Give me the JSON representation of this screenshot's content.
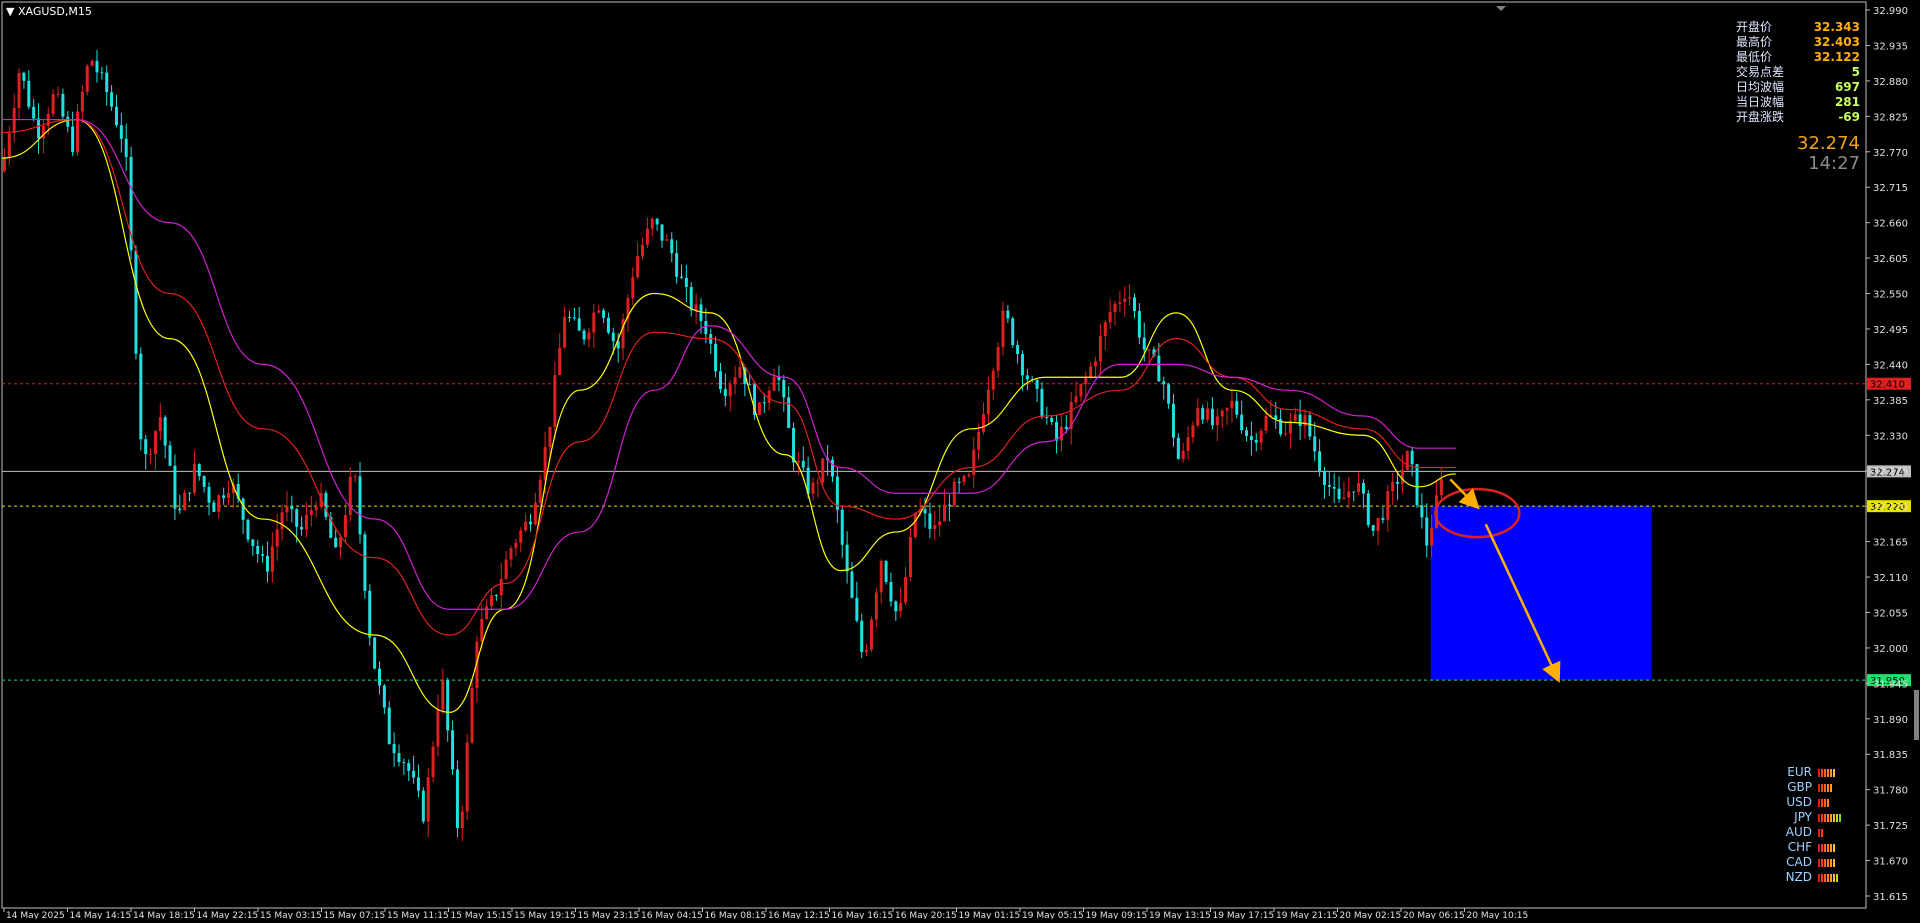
{
  "header": {
    "symbol": "XAGUSD,M15"
  },
  "chart_data": {
    "type": "candlestick",
    "symbol": "XAGUSD",
    "timeframe": "M15",
    "ylim": [
      31.615,
      32.99
    ],
    "y_ticks": [
      32.99,
      32.935,
      32.88,
      32.825,
      32.77,
      32.715,
      32.66,
      32.605,
      32.55,
      32.495,
      32.44,
      32.385,
      32.33,
      32.275,
      32.22,
      32.165,
      32.11,
      32.055,
      32.0,
      31.945,
      31.89,
      31.835,
      31.78,
      31.725,
      31.67,
      31.615
    ],
    "y_tick_labels": [
      "32.990",
      "32.935",
      "32.880",
      "32.825",
      "32.770",
      "32.715",
      "32.660",
      "32.605",
      "32.550",
      "32.495",
      "32.440",
      "32.385",
      "32.330",
      "32.275",
      "32.220",
      "32.165",
      "32.110",
      "32.055",
      "32.000",
      "31.945",
      "31.890",
      "31.835",
      "31.780",
      "31.725",
      "31.670",
      "31.615"
    ],
    "x_tick_labels": [
      "14 May 2025",
      "14 May 14:15",
      "14 May 18:15",
      "14 May 22:15",
      "15 May 03:15",
      "15 May 07:15",
      "15 May 11:15",
      "15 May 15:15",
      "15 May 19:15",
      "15 May 23:15",
      "16 May 04:15",
      "16 May 08:15",
      "16 May 12:15",
      "16 May 16:15",
      "16 May 20:15",
      "19 May 01:15",
      "19 May 05:15",
      "19 May 09:15",
      "19 May 13:15",
      "19 May 17:15",
      "19 May 21:15",
      "20 May 02:15",
      "20 May 06:15",
      "20 May 10:15"
    ],
    "levels": [
      {
        "price": 32.41,
        "label": "32.410",
        "color": "#e02020",
        "style": "dashed"
      },
      {
        "price": 32.274,
        "label": "32.274",
        "color": "#c0c0c0",
        "style": "solid"
      },
      {
        "price": 32.22,
        "label": "32.220",
        "color": "#e8e000",
        "style": "dashed"
      },
      {
        "price": 31.95,
        "label": "31.950",
        "color": "#20e070",
        "style": "dashed"
      }
    ],
    "price_path": [
      32.74,
      32.9,
      32.8,
      32.86,
      32.78,
      32.92,
      32.86,
      32.78,
      32.28,
      32.36,
      32.2,
      32.28,
      32.22,
      32.26,
      32.18,
      32.12,
      32.22,
      32.18,
      32.24,
      32.14,
      32.28,
      32.0,
      31.86,
      31.82,
      31.74,
      31.96,
      31.7,
      32.02,
      32.08,
      32.16,
      32.2,
      32.32,
      32.52,
      32.48,
      32.54,
      32.46,
      32.6,
      32.66,
      32.62,
      32.54,
      32.5,
      32.4,
      32.44,
      32.36,
      32.44,
      32.3,
      32.24,
      32.3,
      32.12,
      31.98,
      32.14,
      32.04,
      32.22,
      32.18,
      32.24,
      32.26,
      32.4,
      32.52,
      32.44,
      32.38,
      32.32,
      32.38,
      32.44,
      32.52,
      32.56,
      32.46,
      32.42,
      32.28,
      32.38,
      32.34,
      32.38,
      32.32,
      32.36,
      32.34,
      32.36,
      32.28,
      32.22,
      32.26,
      32.18,
      32.24,
      32.3,
      32.16,
      32.27
    ],
    "moving_averages": [
      {
        "color": "#ffff00",
        "points": [
          [
            0,
            32.76
          ],
          [
            0.04,
            32.82
          ],
          [
            0.09,
            32.48
          ],
          [
            0.14,
            32.2
          ],
          [
            0.2,
            32.02
          ],
          [
            0.24,
            31.9
          ],
          [
            0.27,
            32.06
          ],
          [
            0.31,
            32.4
          ],
          [
            0.35,
            32.55
          ],
          [
            0.38,
            32.52
          ],
          [
            0.42,
            32.3
          ],
          [
            0.45,
            32.12
          ],
          [
            0.48,
            32.18
          ],
          [
            0.52,
            32.34
          ],
          [
            0.56,
            32.42
          ],
          [
            0.6,
            32.42
          ],
          [
            0.63,
            32.52
          ],
          [
            0.66,
            32.4
          ],
          [
            0.69,
            32.35
          ],
          [
            0.73,
            32.33
          ],
          [
            0.76,
            32.25
          ],
          [
            0.78,
            32.27
          ]
        ]
      },
      {
        "color": "#e02020",
        "points": [
          [
            0,
            32.8
          ],
          [
            0.04,
            32.82
          ],
          [
            0.09,
            32.55
          ],
          [
            0.14,
            32.34
          ],
          [
            0.2,
            32.14
          ],
          [
            0.24,
            32.02
          ],
          [
            0.27,
            32.1
          ],
          [
            0.31,
            32.32
          ],
          [
            0.35,
            32.49
          ],
          [
            0.38,
            32.48
          ],
          [
            0.42,
            32.38
          ],
          [
            0.45,
            32.22
          ],
          [
            0.48,
            32.2
          ],
          [
            0.52,
            32.28
          ],
          [
            0.56,
            32.36
          ],
          [
            0.6,
            32.4
          ],
          [
            0.63,
            32.48
          ],
          [
            0.66,
            32.42
          ],
          [
            0.69,
            32.37
          ],
          [
            0.73,
            32.34
          ],
          [
            0.76,
            32.28
          ],
          [
            0.78,
            32.28
          ]
        ]
      },
      {
        "color": "#d020d0",
        "points": [
          [
            0,
            32.82
          ],
          [
            0.04,
            32.82
          ],
          [
            0.09,
            32.66
          ],
          [
            0.14,
            32.44
          ],
          [
            0.2,
            32.2
          ],
          [
            0.24,
            32.06
          ],
          [
            0.27,
            32.06
          ],
          [
            0.31,
            32.18
          ],
          [
            0.35,
            32.4
          ],
          [
            0.38,
            32.5
          ],
          [
            0.42,
            32.42
          ],
          [
            0.45,
            32.28
          ],
          [
            0.48,
            32.24
          ],
          [
            0.52,
            32.24
          ],
          [
            0.56,
            32.32
          ],
          [
            0.6,
            32.44
          ],
          [
            0.63,
            32.44
          ],
          [
            0.66,
            32.42
          ],
          [
            0.69,
            32.4
          ],
          [
            0.73,
            32.36
          ],
          [
            0.76,
            32.31
          ],
          [
            0.78,
            32.31
          ]
        ]
      }
    ],
    "target_zone": {
      "color": "#0000ff",
      "from_price": 32.22,
      "to_price": 31.95
    },
    "annotations": [
      {
        "type": "ellipse",
        "color": "#e02020"
      },
      {
        "type": "arrow",
        "color": "#ffb000",
        "from": 32.274,
        "to": 32.22
      },
      {
        "type": "arrow",
        "color": "#ffb000",
        "from": 32.22,
        "to": 31.95
      }
    ],
    "grid": false
  },
  "info_panel": {
    "rows": [
      {
        "label": "开盘价",
        "value": "32.343",
        "color": "#ffb000"
      },
      {
        "label": "最高价",
        "value": "32.403",
        "color": "#ffb000"
      },
      {
        "label": "最低价",
        "value": "32.122",
        "color": "#ffb000"
      },
      {
        "label": "交易点差",
        "value": "5",
        "color": "#c8ff60"
      },
      {
        "label": "日均波幅",
        "value": "697",
        "color": "#c8ff60"
      },
      {
        "label": "当日波幅",
        "value": "281",
        "color": "#c8ff60"
      },
      {
        "label": "开盘涨跌",
        "value": "-69",
        "color": "#c8ff60"
      }
    ],
    "last_price": "32.274",
    "timer": "14:27"
  },
  "currency_strength": [
    {
      "name": "EUR",
      "bars": 6
    },
    {
      "name": "GBP",
      "bars": 5
    },
    {
      "name": "USD",
      "bars": 4
    },
    {
      "name": "JPY",
      "bars": 8
    },
    {
      "name": "AUD",
      "bars": 2
    },
    {
      "name": "CHF",
      "bars": 6
    },
    {
      "name": "CAD",
      "bars": 6
    },
    {
      "name": "NZD",
      "bars": 7
    }
  ]
}
